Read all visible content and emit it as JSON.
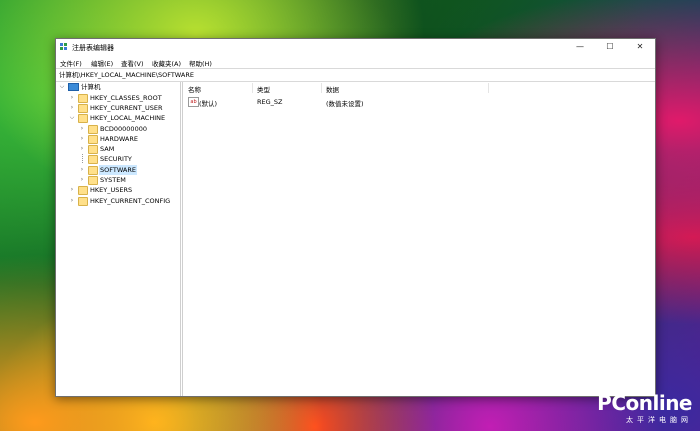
{
  "window": {
    "title": "注册表编辑器",
    "controls": {
      "minimize": "—",
      "maximize": "☐",
      "close": "✕"
    }
  },
  "menu": [
    "文件(F)",
    "编辑(E)",
    "查看(V)",
    "收藏夹(A)",
    "帮助(H)"
  ],
  "address": "计算机\\HKEY_LOCAL_MACHINE\\SOFTWARE",
  "tree": {
    "root": "计算机",
    "hives": [
      {
        "label": "HKEY_CLASSES_ROOT"
      },
      {
        "label": "HKEY_CURRENT_USER"
      },
      {
        "label": "HKEY_LOCAL_MACHINE"
      },
      {
        "label": "HKEY_USERS"
      },
      {
        "label": "HKEY_CURRENT_CONFIG"
      }
    ],
    "hklm_children": [
      "BCD00000000",
      "HARDWARE",
      "SAM",
      "SECURITY",
      "SOFTWARE",
      "SYSTEM"
    ]
  },
  "list": {
    "columns": [
      "名称",
      "类型",
      "数据"
    ],
    "rows": [
      {
        "name": "(默认)",
        "type": "REG_SZ",
        "data": "(数值未设置)"
      }
    ],
    "value_icon": "ab"
  },
  "watermark": {
    "logo": "PConline",
    "sub": "太平洋电脑网"
  }
}
